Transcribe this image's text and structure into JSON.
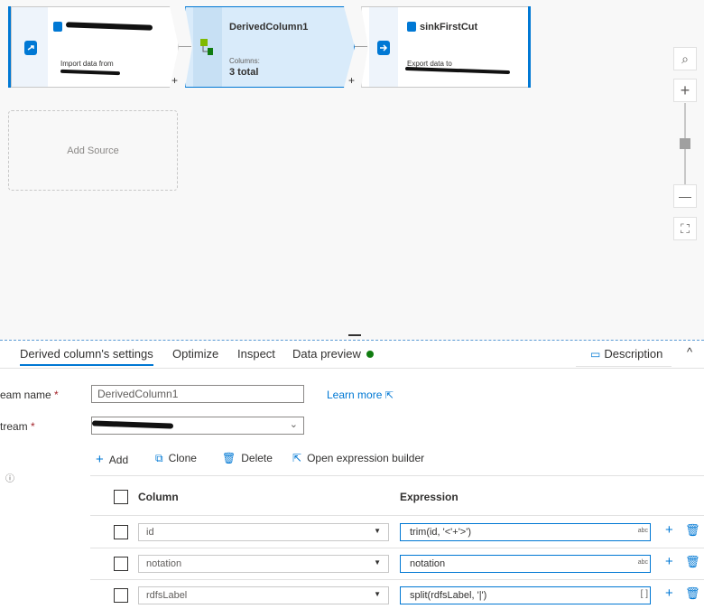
{
  "flow": {
    "source": {
      "subtitle": "Import data from"
    },
    "derived": {
      "title": "DerivedColumn1",
      "columns_label": "Columns:",
      "columns_value": "3 total"
    },
    "sink": {
      "title": "sinkFirstCut",
      "subtitle": "Export data to"
    },
    "plus": "+",
    "add_source": "Add Source"
  },
  "zoom": {
    "search": "⌕",
    "plus": "+",
    "minus": "—",
    "fit": "⛶"
  },
  "tabs": {
    "settings": "Derived column's settings",
    "optimize": "Optimize",
    "inspect": "Inspect",
    "preview": "Data preview",
    "description": "Description",
    "collapse": "^"
  },
  "form": {
    "stream_name_label": "eam name",
    "stream_name_value": "DerivedColumn1",
    "learn_more": "Learn more",
    "incoming_label": "tream",
    "required": "*"
  },
  "toolbar": {
    "add": "Add",
    "clone": "Clone",
    "delete": "Delete",
    "open_builder": "Open expression builder"
  },
  "table": {
    "col_header": "Column",
    "expr_header": "Expression",
    "rows": [
      {
        "column": "id",
        "expression": "trim(id, '<'+'>')",
        "type": "abc"
      },
      {
        "column": "notation",
        "expression": "notation",
        "type": "abc"
      },
      {
        "column": "rdfsLabel",
        "expression": "split(rdfsLabel, '|')",
        "type": "[ ]"
      }
    ]
  },
  "colors": {
    "accent": "#0078d4",
    "status_ok": "#107c10",
    "node_selected": "#d9ebfa"
  }
}
